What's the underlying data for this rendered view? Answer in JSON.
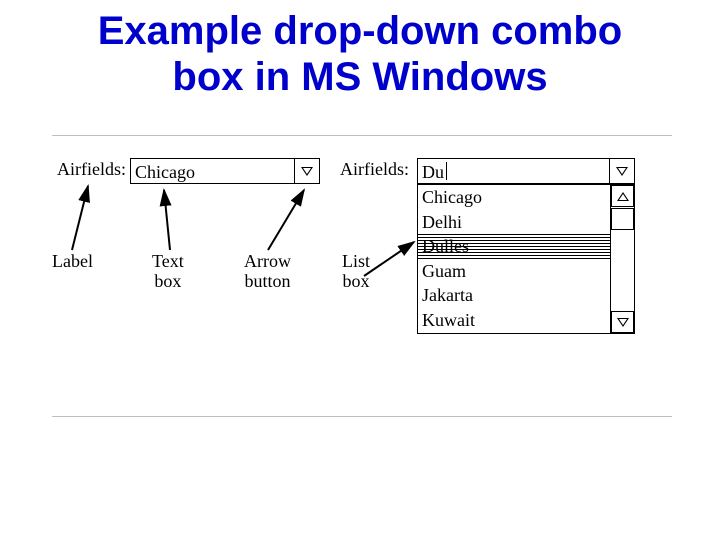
{
  "title_line1": "Example drop-down combo",
  "title_line2": "box in MS Windows",
  "left": {
    "field_label": "Airfields:",
    "value": "Chicago"
  },
  "right": {
    "field_label": "Airfields:",
    "typed_value": "Du",
    "options": [
      "Chicago",
      "Delhi",
      "Dulles",
      "Guam",
      "Jakarta",
      "Kuwait"
    ],
    "selected_index": 2
  },
  "callouts": {
    "label": "Label",
    "textbox_l1": "Text",
    "textbox_l2": "box",
    "arrowbtn_l1": "Arrow",
    "arrowbtn_l2": "button",
    "listbox_l1": "List",
    "listbox_l2": "box"
  }
}
